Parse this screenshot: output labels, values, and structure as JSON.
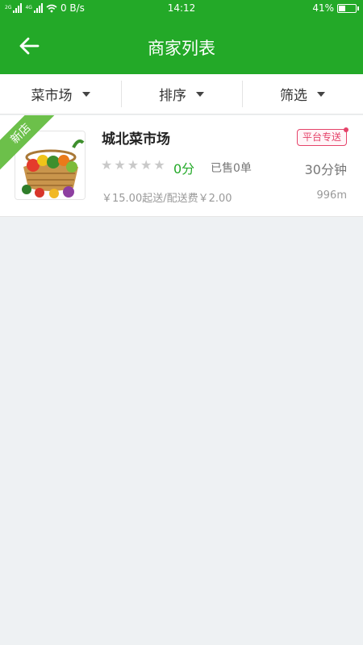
{
  "status_bar": {
    "network_1": "2G",
    "network_2": "4G",
    "speed": "0 B/s",
    "time": "14:12",
    "battery_percent": "41%",
    "battery_level": 0.41
  },
  "app_bar": {
    "title": "商家列表",
    "back_icon": "arrow-left-icon"
  },
  "filters": {
    "category": "菜市场",
    "sort": "排序",
    "filter": "筛选"
  },
  "shops": [
    {
      "ribbon": "新店",
      "name": "城北菜市场",
      "tag": "平台专送",
      "rating_stars": 0,
      "rating_max": 5,
      "score": "0分",
      "sold": "已售0单",
      "delivery_time": "30分钟",
      "min_and_fee": "￥15.00起送/配送费￥2.00",
      "distance": "996m",
      "image_icon": "vegetable-basket-icon"
    }
  ],
  "colors": {
    "primary": "#23a928",
    "ribbon": "#6cc04a",
    "tag": "#e5436a",
    "background": "#eef1f3"
  }
}
